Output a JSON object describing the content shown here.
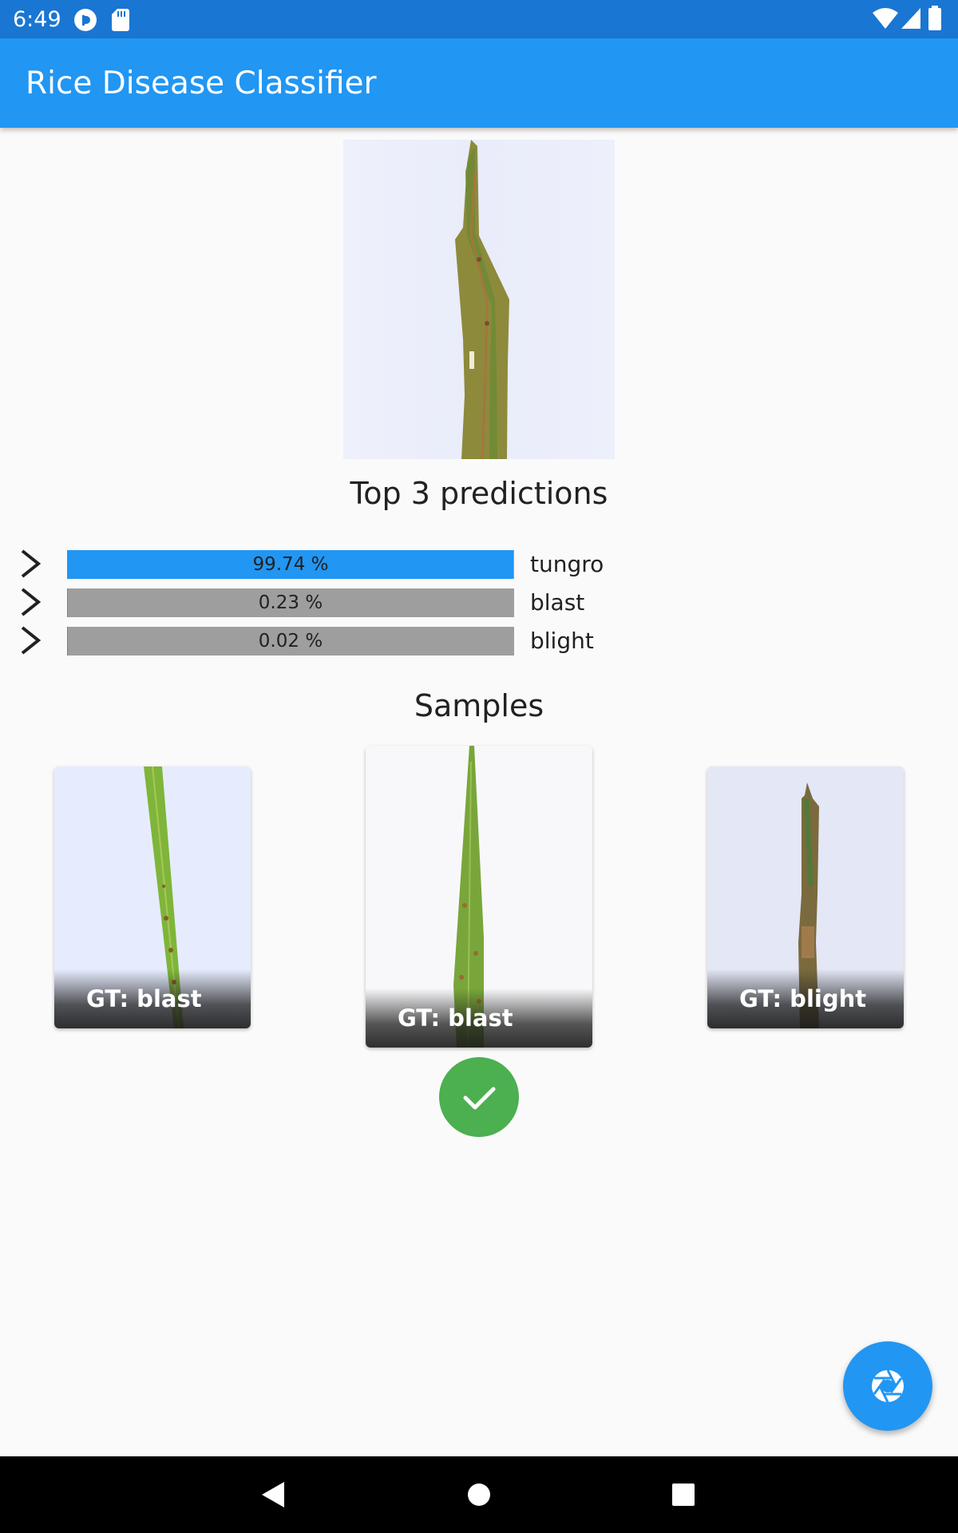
{
  "status_bar": {
    "time": "6:49"
  },
  "app_bar": {
    "title": "Rice Disease Classifier"
  },
  "predictions": {
    "heading": "Top 3 predictions",
    "items": [
      {
        "percent_text": "99.74 %",
        "label": "tungro",
        "value": 0.9974,
        "fill_color": "#2196f3"
      },
      {
        "percent_text": "0.23 %",
        "label": "blast",
        "value": 0.0023,
        "fill_color": "#2196f3"
      },
      {
        "percent_text": "0.02 %",
        "label": "blight",
        "value": 0.0002,
        "fill_color": "#2196f3"
      }
    ]
  },
  "samples": {
    "heading": "Samples",
    "items": [
      {
        "caption": "GT: blast",
        "selected": false
      },
      {
        "caption": "GT: blast",
        "selected": true
      },
      {
        "caption": "GT: blight",
        "selected": false
      }
    ]
  },
  "icons": {
    "status": [
      "pocket-casts-icon",
      "sd-card-icon",
      "wifi-icon",
      "signal-icon",
      "battery-icon"
    ],
    "check": "check-icon",
    "fab": "camera-shutter-icon",
    "nav": [
      "back-icon",
      "home-icon",
      "recents-icon"
    ]
  },
  "colors": {
    "primary": "#2196f3",
    "primary_dark": "#1976d2",
    "success": "#4caf50",
    "bar_bg": "#9e9e9e"
  }
}
